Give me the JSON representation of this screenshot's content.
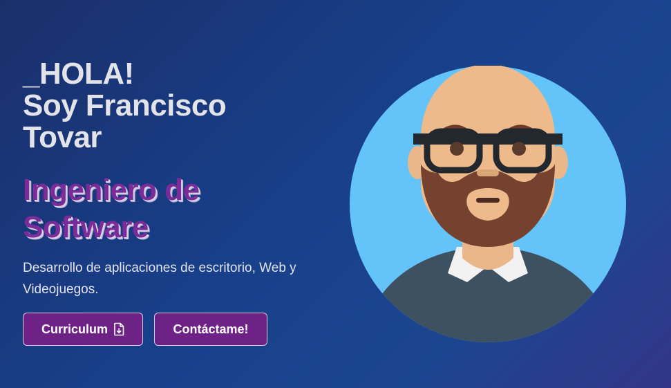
{
  "hero": {
    "greeting_lines": [
      "_HOLA!",
      "Soy Francisco",
      "Tovar"
    ],
    "role_lines": [
      "Ingeniero de",
      "Software"
    ],
    "description": "Desarrollo de aplicaciones de escritorio, Web y Videojuegos."
  },
  "buttons": {
    "curriculum_label": "Curriculum",
    "contact_label": "Contáctame!"
  },
  "icons": {
    "curriculum_icon": "file-download-icon"
  },
  "colors": {
    "background": "#183f8a",
    "accent_purple": "#6e2286",
    "role_text": "#7b2c98",
    "avatar_circle": "#64c4fa"
  }
}
